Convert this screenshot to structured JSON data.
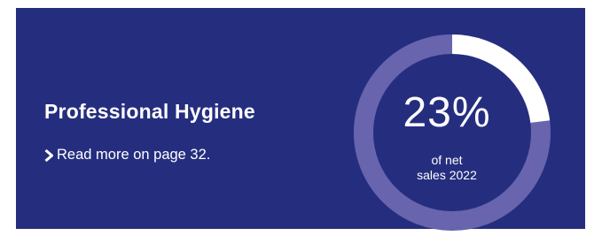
{
  "panel": {
    "background": "#252e7e",
    "heading": "Professional Hygiene",
    "link": {
      "icon": "chevron-right-icon",
      "label": "Read more on page 32."
    }
  },
  "donut": {
    "percent_label": "23%",
    "caption_line1": "of net",
    "caption_line2": "sales 2022",
    "fill_fraction": 0.23,
    "track_color": "#6864ad",
    "fill_color": "#ffffff"
  }
}
